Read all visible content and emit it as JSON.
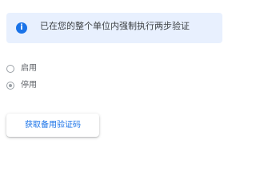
{
  "banner": {
    "icon": "info-icon",
    "icon_glyph": "i",
    "text": "已在您的整个单位内强制执行两步验证",
    "background": "#e8f0fe",
    "icon_color": "#1a73e8"
  },
  "enforcement": {
    "options": [
      {
        "label": "启用",
        "checked": false
      },
      {
        "label": "停用",
        "checked": true
      }
    ]
  },
  "actions": {
    "get_backup_codes_label": "获取备用验证码",
    "accent": "#1a73e8"
  }
}
